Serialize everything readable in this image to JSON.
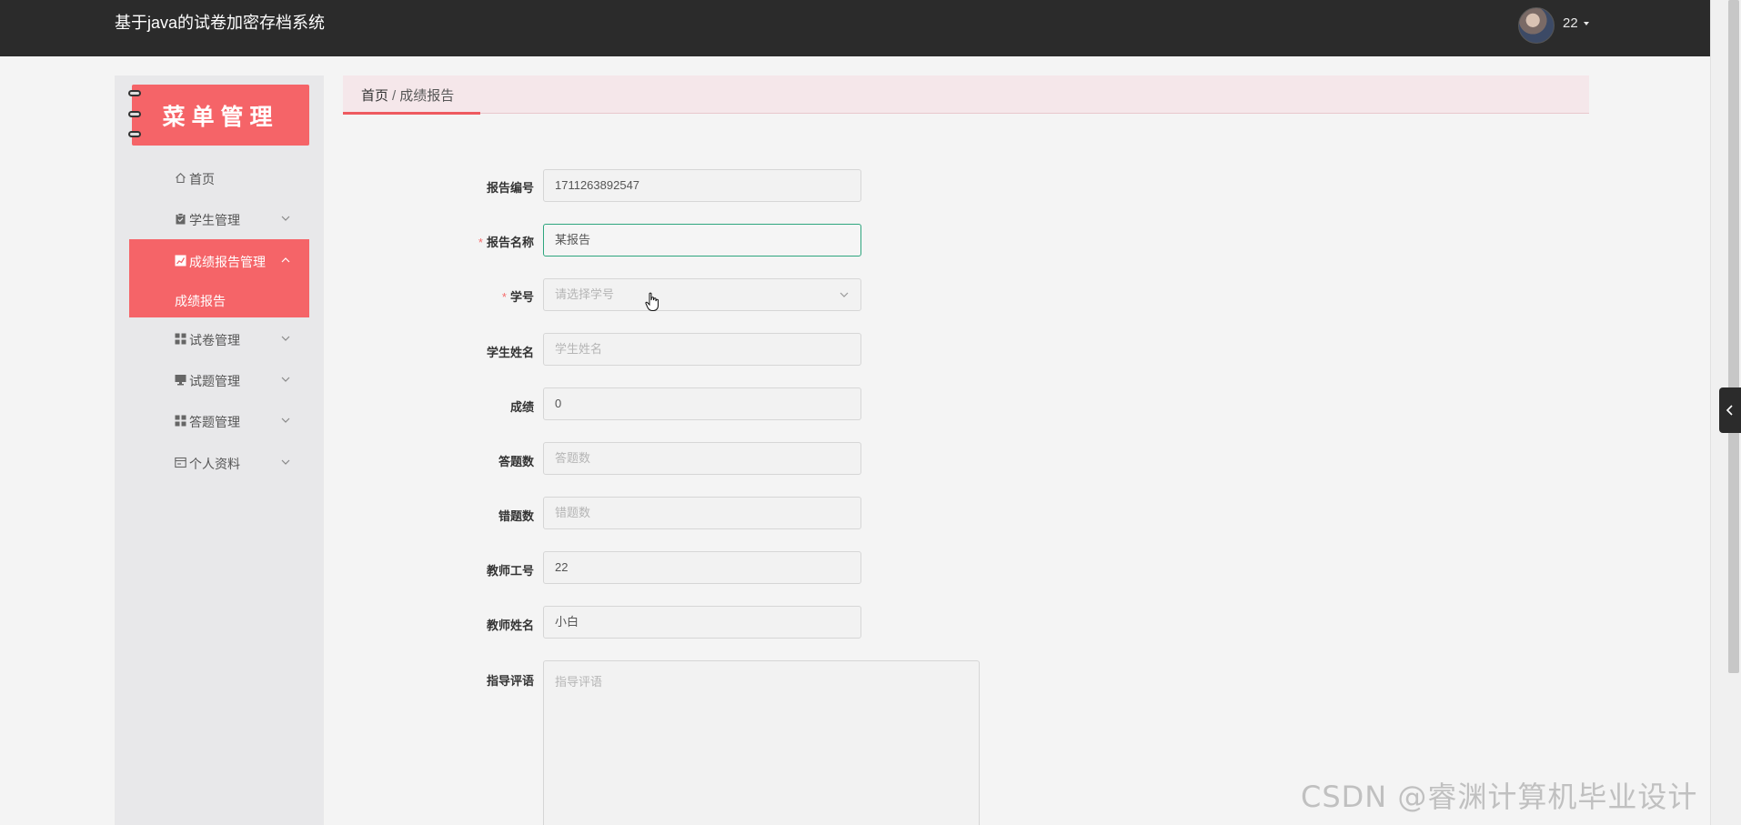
{
  "header": {
    "app_title": "基于java的试卷加密存档系统",
    "username": "22"
  },
  "sidebar": {
    "banner_title": "菜单管理",
    "items": [
      {
        "label": "首页",
        "icon": "home-icon"
      },
      {
        "label": "学生管理",
        "icon": "clipboard-icon"
      },
      {
        "label": "成绩报告管理",
        "icon": "chart-icon",
        "active": true
      },
      {
        "label": "试卷管理",
        "icon": "grid-icon"
      },
      {
        "label": "试题管理",
        "icon": "monitor-icon"
      },
      {
        "label": "答题管理",
        "icon": "grid-icon"
      },
      {
        "label": "个人资料",
        "icon": "card-icon"
      }
    ],
    "submenu": {
      "label": "成绩报告"
    }
  },
  "breadcrumb": {
    "home": "首页",
    "separator": "/",
    "current": "成绩报告"
  },
  "form": {
    "report_no": {
      "label": "报告编号",
      "value": "1711263892547"
    },
    "report_name": {
      "label": "报告名称",
      "value": "某报告",
      "required": true
    },
    "student_no": {
      "label": "学号",
      "placeholder": "请选择学号",
      "required": true
    },
    "student_name": {
      "label": "学生姓名",
      "placeholder": "学生姓名"
    },
    "score": {
      "label": "成绩",
      "value": "0"
    },
    "answer_count": {
      "label": "答题数",
      "placeholder": "答题数"
    },
    "wrong_count": {
      "label": "错题数",
      "placeholder": "错题数"
    },
    "teacher_no": {
      "label": "教师工号",
      "value": "22"
    },
    "teacher_name": {
      "label": "教师姓名",
      "value": "小白"
    },
    "comment": {
      "label": "指导评语",
      "placeholder": "指导评语"
    }
  },
  "watermark": "CSDN @睿渊计算机毕业设计",
  "colors": {
    "topbar": "#2b2b2b",
    "accent": "#f56468",
    "focus": "#2ea57e",
    "required": "#f56c6c"
  }
}
